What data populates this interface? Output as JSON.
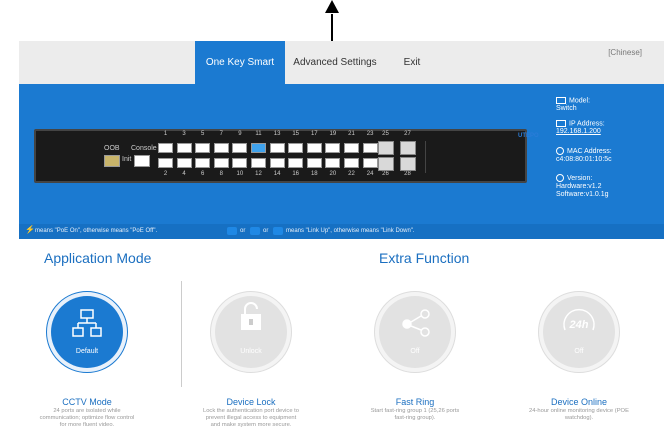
{
  "nav": {
    "tabs": [
      "One Key Smart",
      "Advanced Settings",
      "Exit"
    ],
    "active": "One Key Smart",
    "language": "[Chinese]"
  },
  "device": {
    "oob_label": "OOB",
    "init_label": "Init",
    "console_label": "Console",
    "top_port_numbers": [
      "1",
      "3",
      "5",
      "7",
      "9",
      "11",
      "13",
      "15",
      "17",
      "19",
      "21",
      "23",
      "25",
      "27"
    ],
    "bottom_port_numbers": [
      "2",
      "4",
      "6",
      "8",
      "10",
      "12",
      "14",
      "16",
      "18",
      "20",
      "22",
      "24",
      "26",
      "28"
    ],
    "brand": "UTEPO"
  },
  "info": {
    "model_label": "Model:",
    "model_value": "Switch",
    "ip_label": "IP Address:",
    "ip_value": "192.168.1.200",
    "mac_label": "MAC Address:",
    "mac_value": "c4:08:80:01:10:5c",
    "version_label": "Version:",
    "hardware": "Hardware:v1.2",
    "software": "Software:v1.0.1g"
  },
  "legend": {
    "poe_text": "means \"PoE On\", otherwise means \"PoE Off\".",
    "or1": "or",
    "or2": "or",
    "link_text": "means \"Link Up\", otherwise means \"Link Down\"."
  },
  "sections": {
    "application": "Application Mode",
    "extra": "Extra Function"
  },
  "modes": [
    {
      "name": "CCTV Mode",
      "state": "Default",
      "desc": "24 ports are isolated while communication; optimize flow control for more fluent video.",
      "icon": "network-icon",
      "active": true
    },
    {
      "name": "Device Lock",
      "state": "Unlock",
      "desc": "Lock the authentication port device to prevent illegal access to equipment and make system more secure.",
      "icon": "lock-icon",
      "active": false
    },
    {
      "name": "Fast Ring",
      "state": "Off",
      "desc": "Start fast-ring group 1 (25,26 ports fast-ring group).",
      "icon": "ring-icon",
      "active": false
    },
    {
      "name": "Device Online",
      "state": "Off",
      "desc": "24-hour online monitoring device (POE watchdog).",
      "icon": "24h-icon",
      "active": false
    }
  ],
  "colors": {
    "accent": "#1b7ad1",
    "port_up": "#3fa2ec"
  }
}
